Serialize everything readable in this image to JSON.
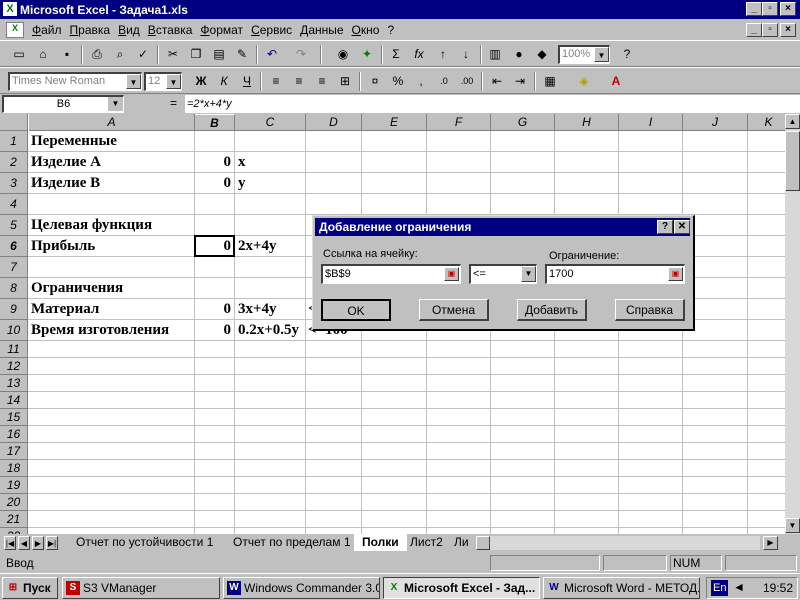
{
  "window": {
    "title": "Microsoft Excel - Задача1.xls"
  },
  "menu": [
    "Файл",
    "Правка",
    "Вид",
    "Вставка",
    "Формат",
    "Сервис",
    "Данные",
    "Окно",
    "?"
  ],
  "toolbar": {
    "zoom": "100%",
    "font": "Times New Roman",
    "size": "12",
    "bold": "Ж",
    "italic": "К",
    "underline": "Ч",
    "sum": "Σ",
    "fx": "fx",
    "percent": "%"
  },
  "formula": {
    "name_box": "B6",
    "eq": "=",
    "content": "=2*x+4*y"
  },
  "columns": [
    "A",
    "B",
    "C",
    "D",
    "E",
    "F",
    "G",
    "H",
    "I",
    "J",
    "K"
  ],
  "rows": [
    "1",
    "2",
    "3",
    "4",
    "5",
    "6",
    "7",
    "8",
    "9",
    "10",
    "11",
    "12",
    "13",
    "14",
    "15",
    "16",
    "17",
    "18",
    "19",
    "20",
    "21",
    "22"
  ],
  "cells": {
    "A1": "Переменные",
    "A2": "Изделие А",
    "B2": "0",
    "C2": "x",
    "A3": "Изделие В",
    "B3": "0",
    "C3": "y",
    "A5": "Целевая функция",
    "A6": "Прибыль",
    "B6": "0",
    "C6": "2x+4y",
    "A8": "Ограничения",
    "A9": "Материал",
    "B9": "0",
    "C9": "3x+4y",
    "D9": "<",
    "A10": "Время изготовления",
    "B10": "0",
    "C10": "0.2x+0.5y",
    "D10": "<=100"
  },
  "dialog": {
    "title": "Добавление ограничения",
    "help_q": "?",
    "close": "✕",
    "cell_ref_label": "Ссылка на ячейку:",
    "cell_ref_value": "$B$9",
    "operator": "<=",
    "constraint_label": "Ограничение:",
    "constraint_value": "1700",
    "ok": "OK",
    "cancel": "Отмена",
    "add": "Добавить",
    "help": "Справка"
  },
  "sheets": [
    "Отчет по устойчивости 1",
    "Отчет по пределам 1",
    "Полки",
    "Лист2",
    "Ли"
  ],
  "active_sheet": "Полки",
  "status": {
    "mode": "Ввод",
    "num": "NUM"
  },
  "taskbar": {
    "start": "Пуск",
    "tasks": [
      "S3 VManager",
      "Windows Commander 3.0...",
      "Microsoft Excel - Зад...",
      "Microsoft Word - МЕТОД..."
    ],
    "lang": "En",
    "clock": "19:52"
  },
  "colors": {
    "titlebar": "#000080",
    "face": "#c0c0c0",
    "selection": "#000000"
  }
}
